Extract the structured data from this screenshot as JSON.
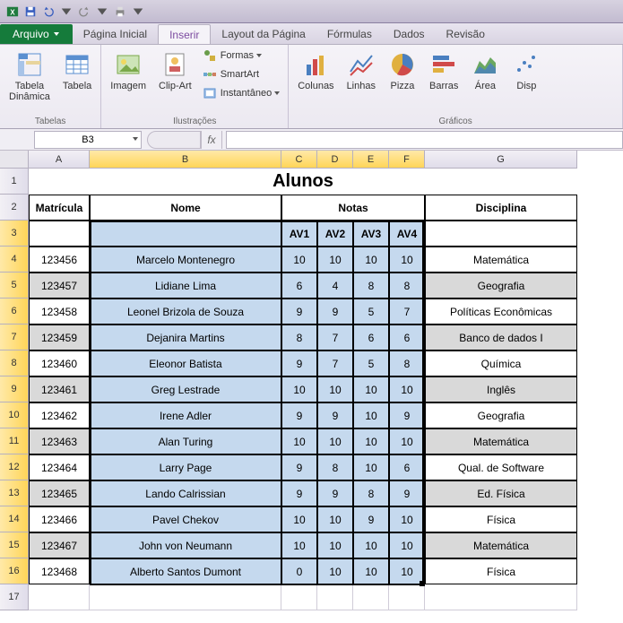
{
  "titlebar": {
    "app_icon": "excel"
  },
  "ribbon": {
    "file_tab": "Arquivo",
    "tabs": [
      "Página Inicial",
      "Inserir",
      "Layout da Página",
      "Fórmulas",
      "Dados",
      "Revisão"
    ],
    "active_tab_index": 1,
    "groups": {
      "tabelas": {
        "label": "Tabelas",
        "btn_dinamica": "Tabela\nDinâmica",
        "btn_tabela": "Tabela"
      },
      "ilustracoes": {
        "label": "Ilustrações",
        "btn_imagem": "Imagem",
        "btn_clipart": "Clip-Art",
        "btn_formas": "Formas",
        "btn_smartart": "SmartArt",
        "btn_instantaneo": "Instantâneo"
      },
      "graficos": {
        "label": "Gráficos",
        "btn_colunas": "Colunas",
        "btn_linhas": "Linhas",
        "btn_pizza": "Pizza",
        "btn_barras": "Barras",
        "btn_area": "Área",
        "btn_dispersao": "Disp"
      }
    }
  },
  "name_box": "B3",
  "fx_label": "fx",
  "columns": [
    "A",
    "B",
    "C",
    "D",
    "E",
    "F",
    "G"
  ],
  "title": "Alunos",
  "headers": {
    "matricula": "Matrícula",
    "nome": "Nome",
    "notas": "Notas",
    "av1": "AV1",
    "av2": "AV2",
    "av3": "AV3",
    "av4": "AV4",
    "disciplina": "Disciplina"
  },
  "rows": [
    {
      "mat": "123456",
      "nome": "Marcelo Montenegro",
      "n": [
        10,
        10,
        10,
        10
      ],
      "disc": "Matemática"
    },
    {
      "mat": "123457",
      "nome": "Lidiane Lima",
      "n": [
        6,
        4,
        8,
        8
      ],
      "disc": "Geografia"
    },
    {
      "mat": "123458",
      "nome": "Leonel Brizola de Souza",
      "n": [
        9,
        9,
        5,
        7
      ],
      "disc": "Políticas Econômicas"
    },
    {
      "mat": "123459",
      "nome": "Dejanira Martins",
      "n": [
        8,
        7,
        6,
        6
      ],
      "disc": "Banco de dados I"
    },
    {
      "mat": "123460",
      "nome": "Eleonor Batista",
      "n": [
        9,
        7,
        5,
        8
      ],
      "disc": "Química"
    },
    {
      "mat": "123461",
      "nome": "Greg Lestrade",
      "n": [
        10,
        10,
        10,
        10
      ],
      "disc": "Inglês"
    },
    {
      "mat": "123462",
      "nome": "Irene Adler",
      "n": [
        9,
        9,
        10,
        9
      ],
      "disc": "Geografia"
    },
    {
      "mat": "123463",
      "nome": "Alan Turing",
      "n": [
        10,
        10,
        10,
        10
      ],
      "disc": "Matemática"
    },
    {
      "mat": "123464",
      "nome": "Larry Page",
      "n": [
        9,
        8,
        10,
        6
      ],
      "disc": "Qual. de Software"
    },
    {
      "mat": "123465",
      "nome": "Lando Calrissian",
      "n": [
        9,
        9,
        8,
        9
      ],
      "disc": "Ed. Física"
    },
    {
      "mat": "123466",
      "nome": "Pavel Chekov",
      "n": [
        10,
        10,
        9,
        10
      ],
      "disc": "Física"
    },
    {
      "mat": "123467",
      "nome": "John von Neumann",
      "n": [
        10,
        10,
        10,
        10
      ],
      "disc": "Matemática"
    },
    {
      "mat": "123468",
      "nome": "Alberto Santos Dumont",
      "n": [
        0,
        10,
        10,
        10
      ],
      "disc": "Física"
    }
  ]
}
